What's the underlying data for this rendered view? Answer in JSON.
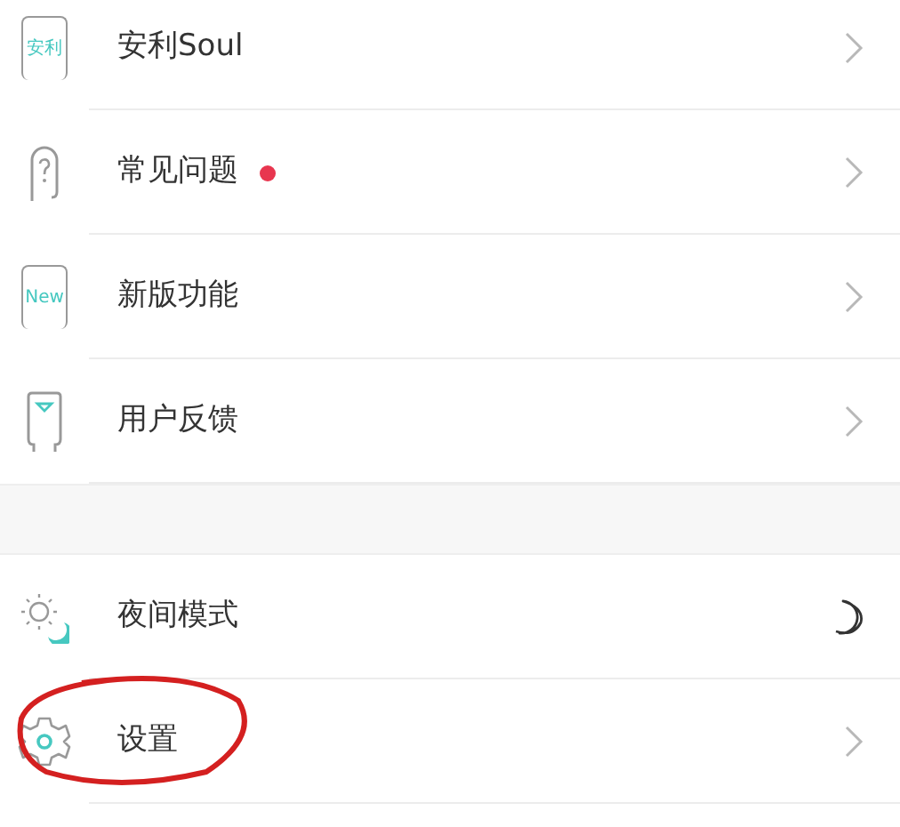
{
  "sections": [
    {
      "items": [
        {
          "icon_text": "安利",
          "label": "安利Soul",
          "kind": "link",
          "unread": false,
          "circled": false
        },
        {
          "label": "常见问题",
          "kind": "link",
          "unread": true,
          "circled": false
        },
        {
          "icon_text": "New",
          "label": "新版功能",
          "kind": "link",
          "unread": false,
          "circled": false
        },
        {
          "label": "用户反馈",
          "kind": "link",
          "unread": false,
          "circled": false
        }
      ]
    },
    {
      "items": [
        {
          "label": "夜间模式",
          "kind": "toggle",
          "unread": false,
          "circled": false
        },
        {
          "label": "设置",
          "kind": "link",
          "unread": false,
          "circled": true
        }
      ]
    }
  ]
}
